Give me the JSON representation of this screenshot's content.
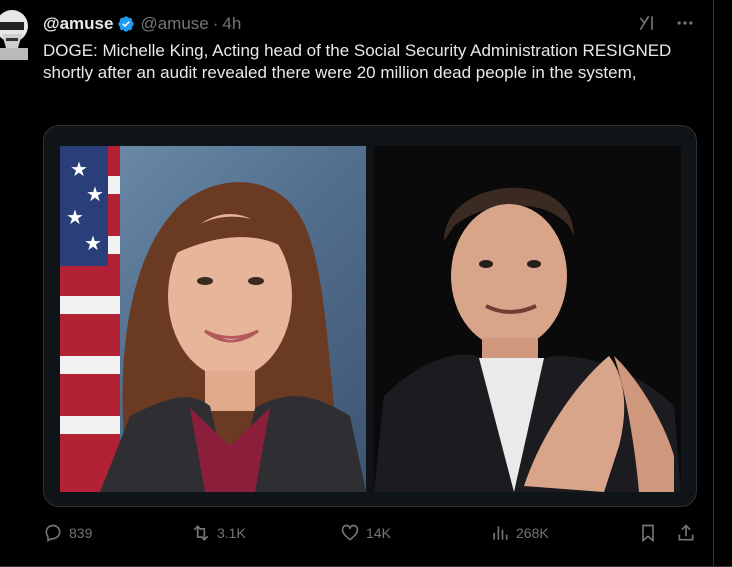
{
  "tweet": {
    "display_name": "@amuse",
    "handle": "@amuse",
    "separator": "·",
    "time": "4h",
    "text": "DOGE: Michelle King, Acting head of the Social Security Administration RESIGNED shortly after an audit revealed there were 20 million dead people in the system,",
    "verified_color": "#1d9bf0"
  },
  "actions": {
    "replies": "839",
    "reposts": "3.1K",
    "likes": "14K",
    "views": "268K"
  },
  "icons": {
    "reply": "reply-icon",
    "repost": "repost-icon",
    "like": "heart-icon",
    "views": "views-icon",
    "bookmark": "bookmark-icon",
    "share": "share-icon",
    "grok": "grok-icon",
    "more": "more-icon"
  }
}
